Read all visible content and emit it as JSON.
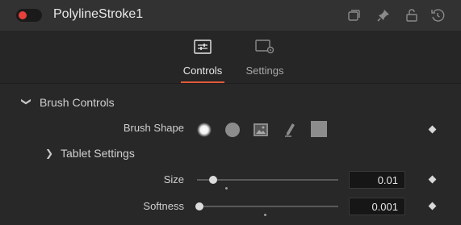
{
  "header": {
    "title": "PolylineStroke1",
    "toggle_state": "on",
    "icons": [
      "collapse-icon",
      "pin-icon",
      "lock-icon",
      "reset-icon"
    ]
  },
  "tabs": [
    {
      "label": "Controls",
      "icon": "sliders-icon",
      "active": true
    },
    {
      "label": "Settings",
      "icon": "settings-icon",
      "active": false
    }
  ],
  "section": {
    "title": "Brush Controls",
    "brush_shape_label": "Brush Shape",
    "brush_shapes": [
      "soft-round-brush-icon",
      "hard-round-brush-icon",
      "image-brush-icon",
      "pencil-brush-icon",
      "square-brush-icon"
    ],
    "tablet_settings_label": "Tablet Settings",
    "size": {
      "label": "Size",
      "value": "0.01",
      "fraction": 0.04
    },
    "softness": {
      "label": "Softness",
      "value": "0.001",
      "fraction": 0.0
    }
  },
  "colors": {
    "accent": "#e25a3c",
    "toggle": "#e8403a"
  }
}
